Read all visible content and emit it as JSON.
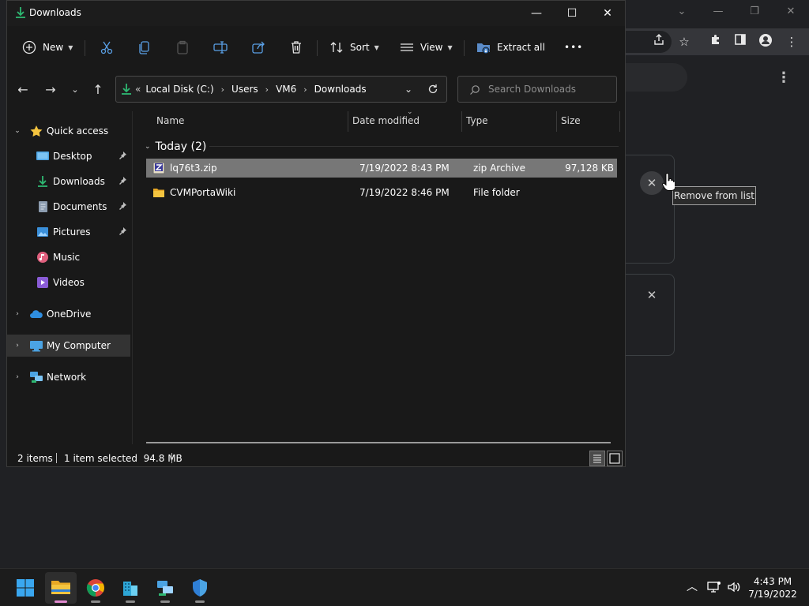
{
  "explorer": {
    "title": "Downloads",
    "title_controls": {
      "minimize": "—",
      "maximize": "☐",
      "close": "✕"
    },
    "commands": {
      "new_label": "New",
      "sort_label": "Sort",
      "view_label": "View",
      "extract_all_label": "Extract all",
      "more_label": "•••"
    },
    "address": {
      "prefix": "«",
      "crumbs": [
        "Local Disk (C:)",
        "Users",
        "VM6",
        "Downloads"
      ]
    },
    "search": {
      "placeholder": "Search Downloads"
    },
    "nav": {
      "quick_access": "Quick access",
      "items": [
        "Desktop",
        "Downloads",
        "Documents",
        "Pictures",
        "Music",
        "Videos"
      ],
      "onedrive": "OneDrive",
      "my_computer": "My Computer",
      "network": "Network"
    },
    "columns": {
      "name": "Name",
      "date": "Date modified",
      "type": "Type",
      "size": "Size"
    },
    "group_label": "Today (2)",
    "files": [
      {
        "name": "lq76t3.zip",
        "date": "7/19/2022 8:43 PM",
        "type": "zip Archive",
        "size": "97,128 KB"
      },
      {
        "name": "CVMPortaWiki",
        "date": "7/19/2022 8:46 PM",
        "type": "File folder",
        "size": ""
      }
    ],
    "status": {
      "count": "2 items",
      "selection": "1 item selected  94.8 MB"
    }
  },
  "chrome": {
    "tooltip": "Remove from list",
    "close_glyph": "✕"
  },
  "taskbar": {
    "time": "4:43 PM",
    "date": "7/19/2022"
  },
  "colors": {
    "accent_green": "#2eb872",
    "folder_yellow": "#f4c43f",
    "selection_gray": "#777777",
    "taskbar_active_indicator": "#e28ad0"
  }
}
